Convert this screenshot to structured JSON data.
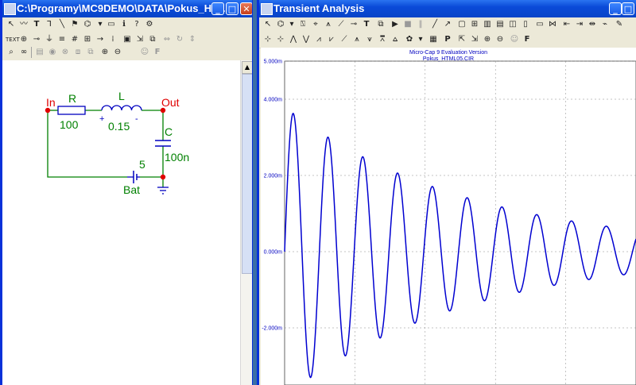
{
  "left_window": {
    "title": "C:\\Programy\\MC9DEMO\\DATA\\Pokus_HT...",
    "circuit": {
      "node_in": "In",
      "node_out": "Out",
      "resistor_name": "R",
      "resistor_value": "100",
      "inductor_name": "L",
      "inductor_value": "0.15",
      "capacitor_name": "C",
      "capacitor_value": "100n",
      "battery_name": "Bat",
      "battery_value": "5",
      "plus_sign": "+",
      "minus_sign": "-"
    }
  },
  "right_window": {
    "title": "Transient Analysis",
    "plot_title_1": "Micro-Cap 9 Evaluation Version",
    "plot_title_2": "Pokus_HTML05.CIR"
  },
  "colors": {
    "wire": "#008000",
    "node": "#e00000",
    "component": "#0000c0",
    "trace": "#0000d0",
    "title_bar": "#0a4ad8"
  },
  "chart_data": {
    "type": "line",
    "title": "Micro-Cap 9 Evaluation Version",
    "subtitle": "Pokus_HTML05.CIR",
    "xlabel": "",
    "ylabel": "",
    "ylim": [
      -3.5,
      5.0
    ],
    "yticks": [
      5,
      4,
      2,
      0,
      -2
    ],
    "ytick_labels": [
      "5.000m",
      "4.000m",
      "2.000m",
      "0.000m",
      "-2.000m"
    ],
    "grid": true,
    "series": [
      {
        "samples": 800,
        "amplitude": 3.8,
        "decay": 1.9,
        "cycles": 10.1
      }
    ]
  }
}
